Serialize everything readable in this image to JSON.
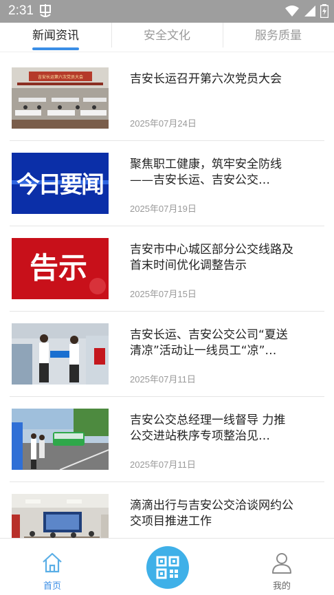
{
  "status_bar": {
    "time": "2:31"
  },
  "tabs": [
    {
      "label": "新闻资讯",
      "active": true
    },
    {
      "label": "安全文化",
      "active": false
    },
    {
      "label": "服务质量",
      "active": false
    }
  ],
  "news": [
    {
      "title": "吉安长运召开第六次党员大会",
      "date": "2025年07月24日",
      "thumb_banner": "吉安长运第六次党员大会"
    },
    {
      "title": "聚焦职工健康，筑牢安全防线——吉安长运、吉安公交…",
      "date": "2025年07月19日",
      "thumb_text": "今日要闻"
    },
    {
      "title": "吉安市中心城区部分公交线路及首末时间优化调整告示",
      "date": "2025年07月15日",
      "thumb_text": "告示"
    },
    {
      "title": "吉安长运、吉安公交公司“夏送清凉”活动让一线员工“凉”…",
      "date": "2025年07月11日"
    },
    {
      "title": "吉安公交总经理一线督导 力推公交进站秩序专项整治见…",
      "date": "2025年07月11日"
    },
    {
      "title": "滴滴出行与吉安公交洽谈网约公交项目推进工作",
      "date": ""
    }
  ],
  "bottom_nav": {
    "home_label": "首页",
    "mine_label": "我的"
  },
  "colors": {
    "accent": "#3a8ee6",
    "scan": "#3fb0e8",
    "status_bar": "#9e9e9e"
  }
}
